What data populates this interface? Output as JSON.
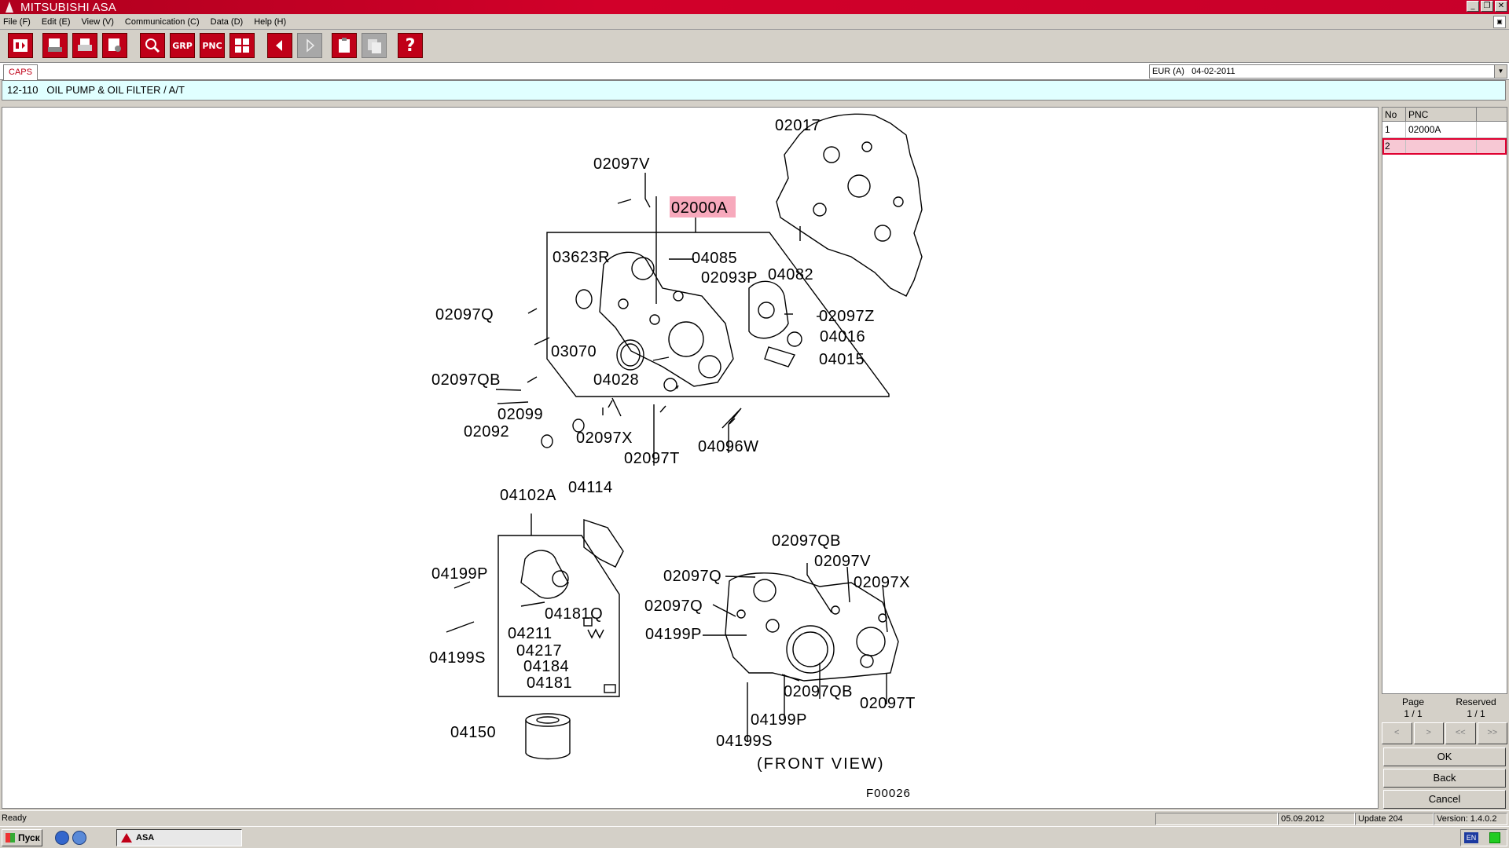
{
  "window": {
    "title": "MITSUBISHI ASA"
  },
  "menu": [
    "File (F)",
    "Edit (E)",
    "View (V)",
    "Communication (C)",
    "Data (D)",
    "Help (H)"
  ],
  "toolbar": {
    "grp_label": "GRP",
    "pnc_label": "PNC",
    "help_label": "?",
    "icons": [
      "catalog-icon",
      "print-preview-icon",
      "print-icon",
      "page-setup-icon",
      "zoom-icon",
      "grp-icon",
      "pnc-icon",
      "grid-icon",
      "back-arrow-icon",
      "forward-arrow-icon",
      "clipboard-icon",
      "copy-disabled-icon",
      "help-icon"
    ]
  },
  "caps": {
    "tab": "CAPS",
    "region": "EUR (A)",
    "date": "04-02-2011"
  },
  "breadcrumb": {
    "code": "12-110",
    "title": "OIL PUMP & OIL FILTER / A/T"
  },
  "diagram": {
    "highlight": "02000A",
    "labels": [
      "02017",
      "02097V",
      "02000A",
      "03623R",
      "04085",
      "02093P",
      "04082",
      "02097Q",
      "02097Z",
      "04016",
      "03070",
      "04015",
      "02097QB",
      "04028",
      "02099",
      "02092",
      "02097X",
      "02097T",
      "04096W",
      "04102A",
      "04114",
      "04199P",
      "04181Q",
      "04211",
      "04217",
      "04184",
      "04181",
      "04199S",
      "04150",
      "02097QB",
      "02097V",
      "02097Q",
      "02097X",
      "02097Q",
      "04199P",
      "02097QB",
      "04199P",
      "02097T",
      "04199S"
    ],
    "front_view": "(FRONT VIEW)",
    "figure_id": "F00026"
  },
  "pnc_table": {
    "headers": [
      "No",
      "PNC",
      ""
    ],
    "rows": [
      {
        "no": "1",
        "pnc": "02000A"
      },
      {
        "no": "2",
        "pnc": ""
      }
    ]
  },
  "paging": {
    "page_label": "Page",
    "page_value": "1 / 1",
    "reserved_label": "Reserved",
    "reserved_value": "1 / 1"
  },
  "nav": [
    "<",
    ">",
    "<<",
    ">>"
  ],
  "buttons": {
    "ok": "OK",
    "back": "Back",
    "cancel": "Cancel"
  },
  "status": {
    "ready": "Ready",
    "date": "05.09.2012",
    "update": "Update 204",
    "version": "Version: 1.4.0.2"
  },
  "taskbar": {
    "start": "Пуск",
    "task": "ASA",
    "lang": "EN"
  }
}
